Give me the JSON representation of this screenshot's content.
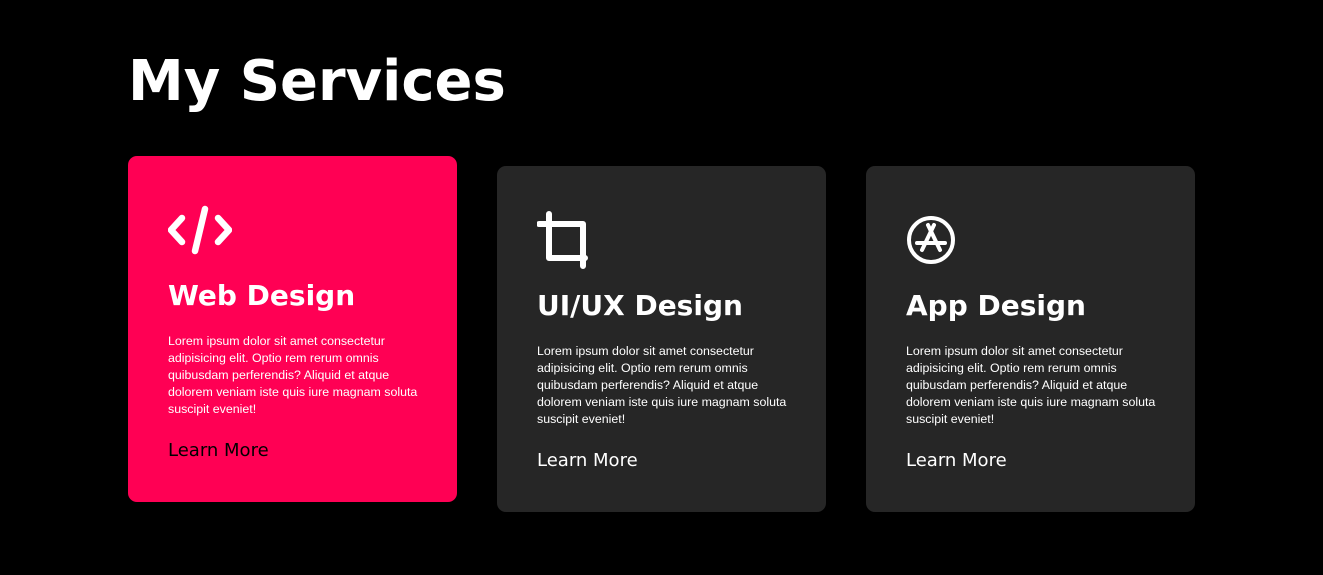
{
  "section": {
    "title": "My Services"
  },
  "colors": {
    "background": "#000000",
    "card": "#262626",
    "accent": "#ff0054",
    "text": "#ffffff"
  },
  "cards": [
    {
      "icon": "code-icon",
      "title": "Web Design",
      "description": "Lorem ipsum dolor sit amet consectetur adipisicing elit. Optio rem rerum omnis quibusdam perferendis? Aliquid et atque dolorem veniam iste quis iure magnam soluta suscipit eveniet!",
      "link_label": "Learn More",
      "active": true
    },
    {
      "icon": "crop-icon",
      "title": "UI/UX Design",
      "description": "Lorem ipsum dolor sit amet consectetur adipisicing elit. Optio rem rerum omnis quibusdam perferendis? Aliquid et atque dolorem veniam iste quis iure magnam soluta suscipit eveniet!",
      "link_label": "Learn More",
      "active": false
    },
    {
      "icon": "app-store-icon",
      "title": "App Design",
      "description": "Lorem ipsum dolor sit amet consectetur adipisicing elit. Optio rem rerum omnis quibusdam perferendis? Aliquid et atque dolorem veniam iste quis iure magnam soluta suscipit eveniet!",
      "link_label": "Learn More",
      "active": false
    }
  ]
}
